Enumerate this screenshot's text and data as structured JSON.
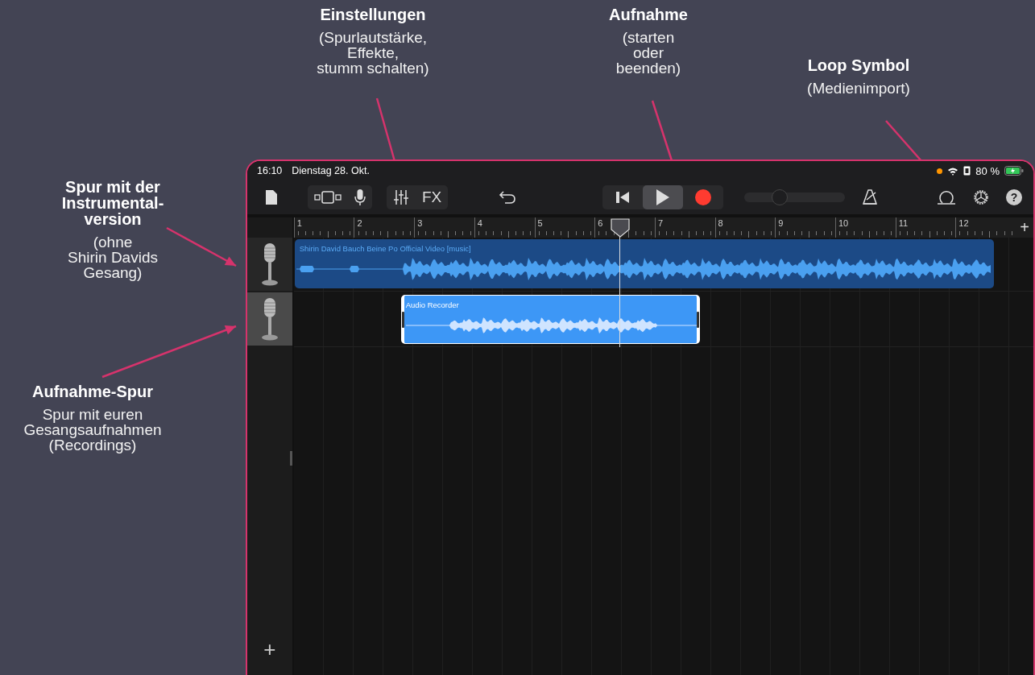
{
  "annotations": [
    {
      "title": [
        "Spur mit der",
        "Instrumental-",
        "version"
      ],
      "note": [
        "(ohne",
        "Shirin Davids",
        "Gesang)"
      ]
    },
    {
      "title": [
        "Aufnahme-Spur"
      ],
      "note": [
        "Spur mit euren",
        "Gesangsaufnahmen",
        "(Recordings)"
      ]
    },
    {
      "title": [
        "Einstellungen"
      ],
      "note": [
        "(Spurlautstärke,",
        "Effekte,",
        "stumm schalten)"
      ]
    },
    {
      "title": [
        "Aufnahme"
      ],
      "note": [
        "(starten",
        "oder",
        "beenden)"
      ]
    },
    {
      "title": [
        "Loop Symbol"
      ],
      "note": [
        "(Medienimport)"
      ]
    }
  ],
  "status_bar": {
    "time": "16:10",
    "date": "Dienstag 28. Okt.",
    "battery": "80 %"
  },
  "toolbar": {
    "fx": "FX",
    "transport": [
      {
        "kind": "rewind",
        "selected": false
      },
      {
        "kind": "play",
        "selected": true
      },
      {
        "kind": "record",
        "selected": false
      }
    ],
    "volume": {
      "level": 0.35
    },
    "help": "?"
  },
  "ruler": {
    "bars": [
      "1",
      "2",
      "3",
      "4",
      "5",
      "6",
      "7",
      "8",
      "9",
      "10",
      "11",
      "12"
    ],
    "add": "+"
  },
  "tracks": [
    {
      "selected": false,
      "region": {
        "name": "Shirin David Bauch Beine Po Official Video [music]",
        "selected": false
      }
    },
    {
      "selected": true,
      "region": {
        "name": "Audio Recorder",
        "selected": true
      }
    }
  ],
  "add_track": "+"
}
